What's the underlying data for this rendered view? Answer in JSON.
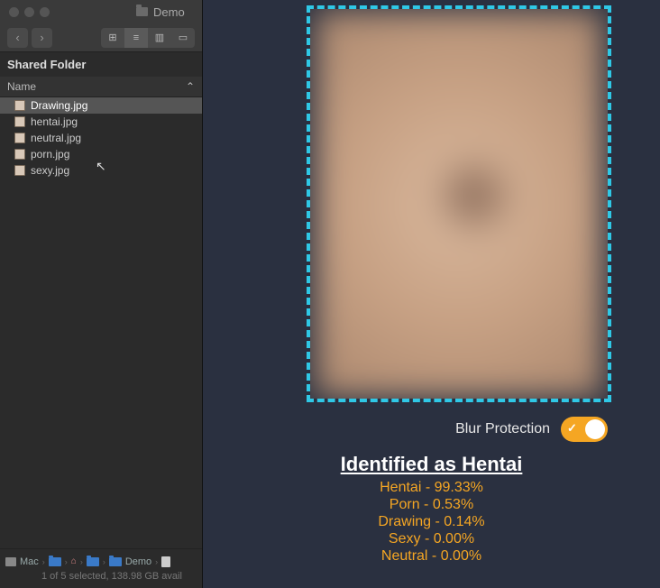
{
  "finder": {
    "folder_title": "Demo",
    "section": "Shared Folder",
    "column_label": "Name",
    "sort_indicator": "⌃",
    "files": [
      {
        "name": "Drawing.jpg",
        "selected": true
      },
      {
        "name": "hentai.jpg",
        "selected": false
      },
      {
        "name": "neutral.jpg",
        "selected": false
      },
      {
        "name": "porn.jpg",
        "selected": false
      },
      {
        "name": "sexy.jpg",
        "selected": false
      }
    ],
    "path": [
      "Mac",
      "folder",
      "home",
      "folder",
      "Demo",
      "doc"
    ],
    "path_start_label": "Mac",
    "path_demo_label": "Demo",
    "status": "1 of 5 selected, 138.98 GB avail"
  },
  "classifier": {
    "blur_label": "Blur Protection",
    "blur_on": true,
    "title": "Identified as Hentai",
    "scores": [
      {
        "label": "Hentai",
        "value": "99.33%"
      },
      {
        "label": "Porn",
        "value": "0.53%"
      },
      {
        "label": "Drawing",
        "value": "0.14%"
      },
      {
        "label": "Sexy",
        "value": "0.00%"
      },
      {
        "label": "Neutral",
        "value": "0.00%"
      }
    ]
  }
}
